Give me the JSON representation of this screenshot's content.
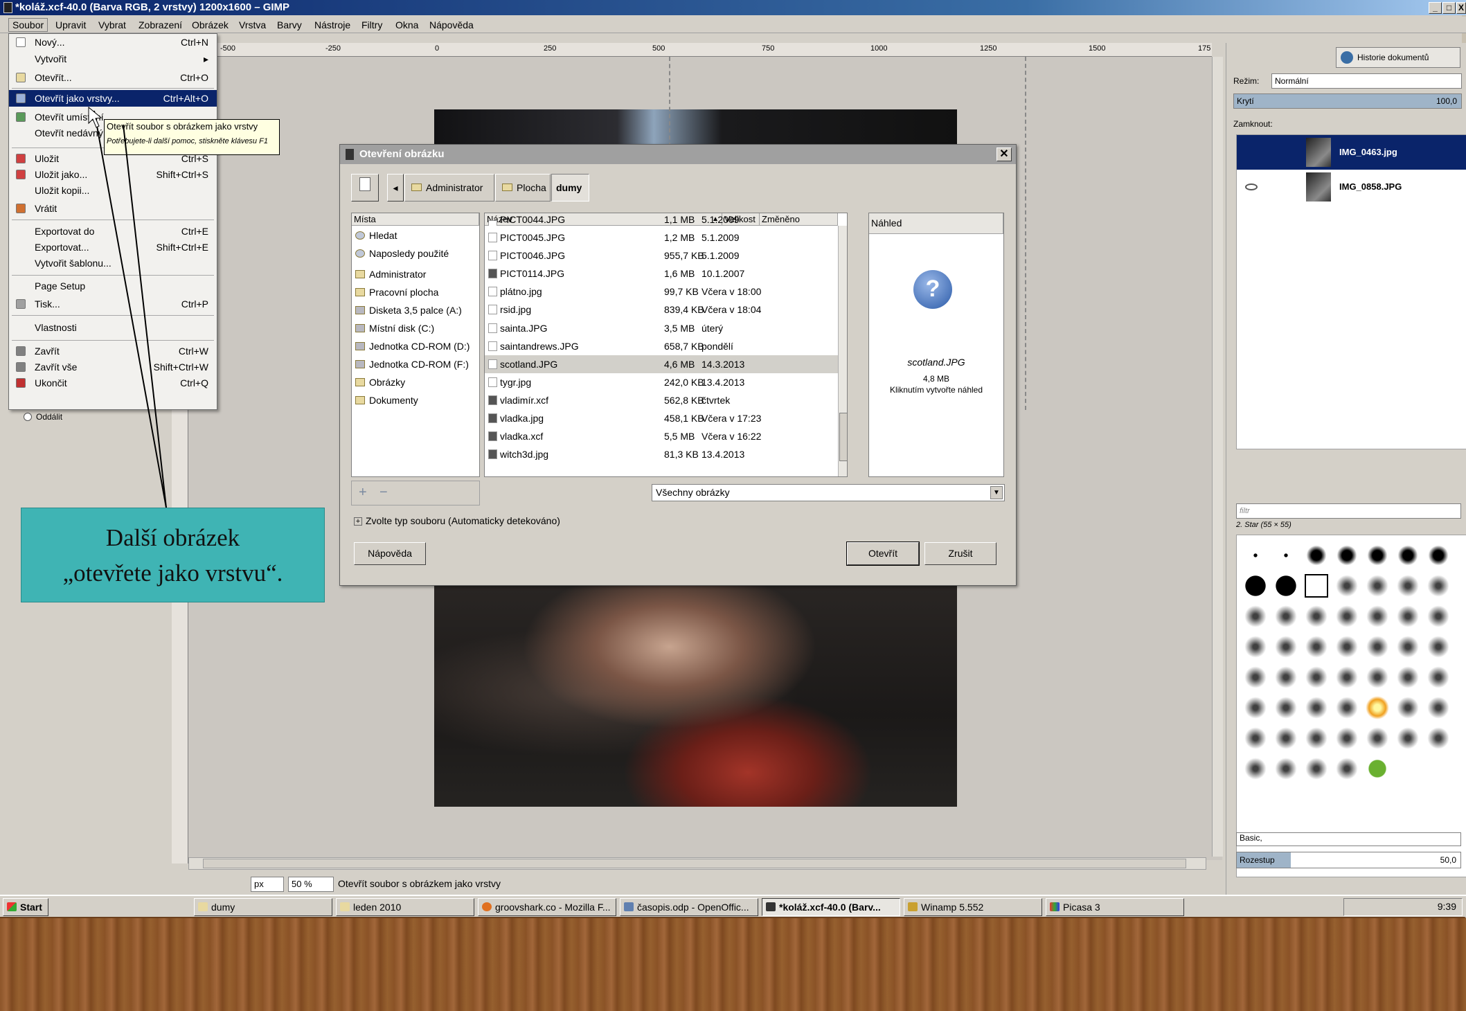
{
  "window": {
    "title": "*koláž.xcf-40.0 (Barva RGB, 2 vrstvy) 1200x1600 – GIMP"
  },
  "menubar": [
    "Soubor",
    "Upravit",
    "Vybrat",
    "Zobrazení",
    "Obrázek",
    "Vrstva",
    "Barvy",
    "Nástroje",
    "Filtry",
    "Okna",
    "Nápověda"
  ],
  "ruler_ticks": [
    "-500",
    "-250",
    "0",
    "250",
    "500",
    "750",
    "1000",
    "1250",
    "1500",
    "175"
  ],
  "file_menu": [
    {
      "label": "Nový...",
      "accel": "Ctrl+N"
    },
    {
      "label": "Vytvořit",
      "accel": "▸"
    },
    {
      "label": "Otevřít...",
      "accel": "Ctrl+O"
    },
    {
      "label": "Otevřít jako vrstvy...",
      "accel": "Ctrl+Alt+O"
    },
    {
      "label": "Otevřít umístění...",
      "accel": ""
    },
    {
      "label": "Otevřít nedávný",
      "accel": ""
    },
    {
      "label": "Uložit",
      "accel": "Ctrl+S"
    },
    {
      "label": "Uložit jako...",
      "accel": "Shift+Ctrl+S"
    },
    {
      "label": "Uložit kopii...",
      "accel": ""
    },
    {
      "label": "Vrátit",
      "accel": ""
    },
    {
      "label": "Exportovat do",
      "accel": "Ctrl+E"
    },
    {
      "label": "Exportovat...",
      "accel": "Shift+Ctrl+E"
    },
    {
      "label": "Vytvořit šablonu...",
      "accel": ""
    },
    {
      "label": "Page Setup",
      "accel": ""
    },
    {
      "label": "Tisk...",
      "accel": "Ctrl+P"
    },
    {
      "label": "Vlastnosti",
      "accel": ""
    },
    {
      "label": "Zavřít",
      "accel": "Ctrl+W"
    },
    {
      "label": "Zavřít vše",
      "accel": "Shift+Ctrl+W"
    },
    {
      "label": "Ukončit",
      "accel": "Ctrl+Q"
    }
  ],
  "tooltip": {
    "main": "Otevřít soubor s obrázkem jako vrstvy",
    "help": "Potřebujete-li další pomoc, stiskněte klávesu F1"
  },
  "zoom_out_label": "Oddálit",
  "dialog": {
    "title": "Otevření obrázku",
    "path": [
      "Administrator",
      "Plocha",
      "dumy"
    ],
    "places_header": "Místa",
    "places": [
      "Hledat",
      "Naposledy použité",
      "Administrator",
      "Pracovní plocha",
      "Disketa 3,5 palce (A:)",
      "Místní disk (C:)",
      "Jednotka CD-ROM (D:)",
      "Jednotka CD-ROM (F:)",
      "Obrázky",
      "Dokumenty"
    ],
    "columns": {
      "name": "Název",
      "size": "Velikost",
      "modified": "Změněno"
    },
    "files": [
      {
        "name": "PICT0044.JPG",
        "size": "1,1 MB",
        "date": "5.1.2009"
      },
      {
        "name": "PICT0045.JPG",
        "size": "1,2 MB",
        "date": "5.1.2009"
      },
      {
        "name": "PICT0046.JPG",
        "size": "955,7 KB",
        "date": "5.1.2009"
      },
      {
        "name": "PICT0114.JPG",
        "size": "1,6 MB",
        "date": "10.1.2007"
      },
      {
        "name": "plátno.jpg",
        "size": "99,7 KB",
        "date": "Včera v 18:00"
      },
      {
        "name": "rsid.jpg",
        "size": "839,4 KB",
        "date": "Včera v 18:04"
      },
      {
        "name": "sainta.JPG",
        "size": "3,5 MB",
        "date": "úterý"
      },
      {
        "name": "saintandrews.JPG",
        "size": "658,7 KB",
        "date": "pondělí"
      },
      {
        "name": "scotland.JPG",
        "size": "4,6 MB",
        "date": "14.3.2013"
      },
      {
        "name": "tygr.jpg",
        "size": "242,0 KB",
        "date": "13.4.2013"
      },
      {
        "name": "vladimír.xcf",
        "size": "562,8 KB",
        "date": "čtvrtek"
      },
      {
        "name": "vladka.jpg",
        "size": "458,1 KB",
        "date": "Včera v 17:23"
      },
      {
        "name": "vladka.xcf",
        "size": "5,5 MB",
        "date": "Včera v 16:22"
      },
      {
        "name": "witch3d.jpg",
        "size": "81,3 KB",
        "date": "13.4.2013"
      }
    ],
    "preview_header": "Náhled",
    "preview_name": "scotland.JPG",
    "preview_size": "4,8 MB",
    "preview_hint": "Kliknutím vytvořte náhled",
    "filter": "Všechny obrázky",
    "filetype": "Zvolte typ souboru (Automaticky detekováno)",
    "help_btn": "Nápověda",
    "open_btn": "Otevřít",
    "cancel_btn": "Zrušit"
  },
  "dock": {
    "history_tab": "Historie dokumentů",
    "mode_label": "Režim:",
    "mode_value": "Normální",
    "opacity_label": "Krytí",
    "opacity_value": "100,0",
    "lock_label": "Zamknout:",
    "layers": [
      "IMG_0463.jpg",
      "IMG_0858.JPG"
    ],
    "filter_placeholder": "filtr",
    "brush_name": "2. Star (55 × 55)",
    "preset": "Basic,",
    "spacing_label": "Rozestup",
    "spacing_value": "50,0"
  },
  "statusbar": {
    "unit": "px",
    "zoom": "50 %",
    "message": "Otevřít soubor s obrázkem jako vrstvy"
  },
  "taskbar": {
    "start": "Start",
    "tasks": [
      "dumy",
      "leden 2010",
      "groovshark.co - Mozilla F...",
      "časopis.odp - OpenOffic...",
      "*koláž.xcf-40.0 (Barv...",
      "Winamp 5.552",
      "Picasa 3"
    ],
    "clock": "9:39"
  },
  "callout": {
    "line1": "Další obrázek",
    "line2": "„otevřete jako vrstvu“."
  }
}
